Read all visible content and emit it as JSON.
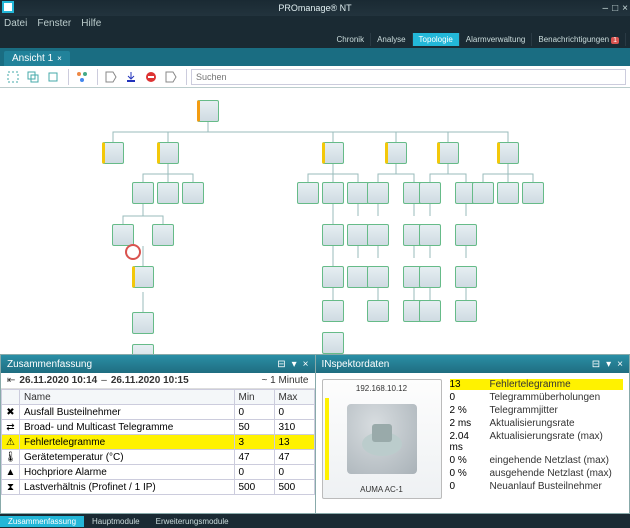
{
  "app": {
    "title": "PROmanage® NT",
    "window_controls": {
      "min": "–",
      "max": "□",
      "close": "×"
    }
  },
  "menu": [
    "Datei",
    "Fenster",
    "Hilfe"
  ],
  "top_nav": [
    {
      "label": "Chronik",
      "active": false,
      "badge": ""
    },
    {
      "label": "Analyse",
      "active": false,
      "badge": ""
    },
    {
      "label": "Topologie",
      "active": true,
      "badge": ""
    },
    {
      "label": "Alarmverwaltung",
      "active": false,
      "badge": ""
    },
    {
      "label": "Benachrichtigungen",
      "active": false,
      "badge": "1"
    }
  ],
  "view_tab": {
    "label": "Ansicht 1",
    "close": "×"
  },
  "toolbar": {
    "search_placeholder": "Suchen"
  },
  "summary": {
    "title": "Zusammenfassung",
    "date_from": "26.11.2020 10:14",
    "date_sep": "–",
    "date_to": "26.11.2020 10:15",
    "duration": "~ 1 Minute",
    "cols": {
      "name": "Name",
      "min": "Min",
      "max": "Max"
    },
    "rows": [
      {
        "name": "Ausfall Busteilnehmer",
        "min": "0",
        "max": "0",
        "hl": false
      },
      {
        "name": "Broad- und Multicast Telegramme",
        "min": "50",
        "max": "310",
        "hl": false
      },
      {
        "name": "Fehlertelegramme",
        "min": "3",
        "max": "13",
        "hl": true
      },
      {
        "name": "Gerätetemperatur (°C)",
        "min": "47",
        "max": "47",
        "hl": false
      },
      {
        "name": "Hochpriore Alarme",
        "min": "0",
        "max": "0",
        "hl": false
      },
      {
        "name": "Lastverhältnis (Profinet / 1 IP)",
        "min": "500",
        "max": "500",
        "hl": false
      }
    ]
  },
  "inspector": {
    "title": "INspektordaten",
    "device": {
      "ip": "192.168.10.12",
      "name": "AUMA AC-1"
    },
    "props": [
      {
        "val": "13",
        "label": "Fehlertelegramme",
        "hl": true
      },
      {
        "val": "0",
        "label": "Telegrammüberholungen",
        "hl": false
      },
      {
        "val": "2 %",
        "label": "Telegrammjitter",
        "hl": false
      },
      {
        "val": "2 ms",
        "label": "Aktualisierungsrate",
        "hl": false
      },
      {
        "val": "2.04 ms",
        "label": "Aktualisierungsrate (max)",
        "hl": false
      },
      {
        "val": "0 %",
        "label": "eingehende Netzlast (max)",
        "hl": false
      },
      {
        "val": "0 %",
        "label": "ausgehende Netzlast (max)",
        "hl": false
      },
      {
        "val": "0",
        "label": "Neuanlauf Busteilnehmer",
        "hl": false
      }
    ]
  },
  "bottom_tabs": [
    {
      "label": "Zusammenfassung",
      "active": true
    },
    {
      "label": "Hauptmodule",
      "active": false
    },
    {
      "label": "Erweiterungsmodule",
      "active": false
    }
  ]
}
